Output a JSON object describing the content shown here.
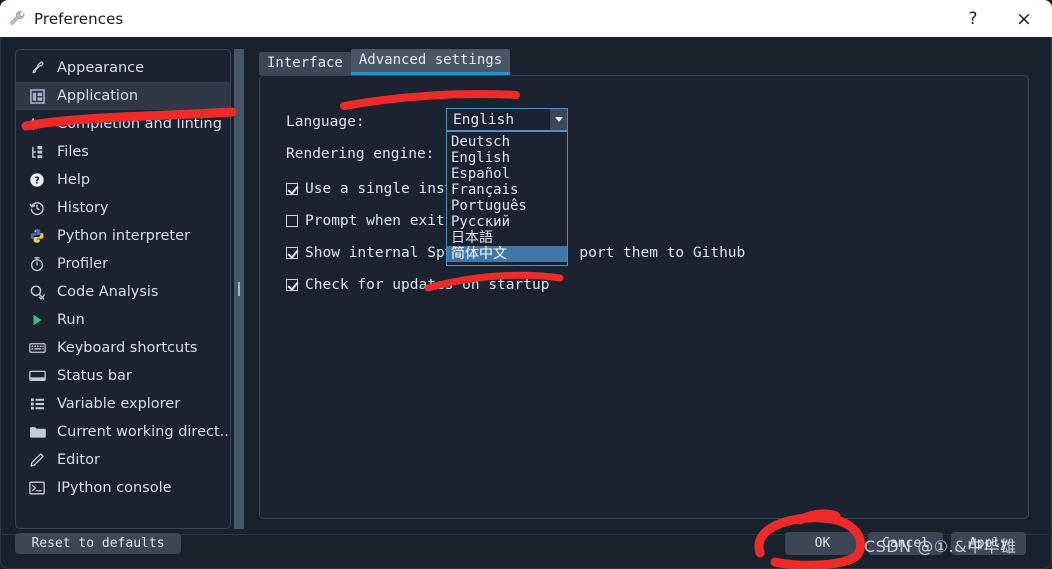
{
  "window": {
    "title": "Preferences",
    "icon": "wrench-icon",
    "help_label": "?",
    "close_label": "×"
  },
  "sidebar": {
    "items": [
      {
        "label": "Appearance",
        "icon": "eyedropper-icon",
        "active": false
      },
      {
        "label": "Application",
        "icon": "application-grid-icon",
        "active": true
      },
      {
        "label": "Completion and linting",
        "icon": "check-arrow-icon",
        "active": false
      },
      {
        "label": "Files",
        "icon": "file-tree-icon",
        "active": false
      },
      {
        "label": "Help",
        "icon": "question-circle-icon",
        "active": false
      },
      {
        "label": "History",
        "icon": "clock-back-icon",
        "active": false
      },
      {
        "label": "Python interpreter",
        "icon": "python-icon",
        "active": false
      },
      {
        "label": "Profiler",
        "icon": "stopwatch-icon",
        "active": false
      },
      {
        "label": "Code Analysis",
        "icon": "magnifier-check-icon",
        "active": false
      },
      {
        "label": "Run",
        "icon": "play-triangle-icon",
        "active": false
      },
      {
        "label": "Keyboard shortcuts",
        "icon": "keyboard-icon",
        "active": false
      },
      {
        "label": "Status bar",
        "icon": "status-bar-icon",
        "active": false
      },
      {
        "label": "Variable explorer",
        "icon": "list-icon",
        "active": false
      },
      {
        "label": "Current working direct...",
        "icon": "folder-icon",
        "active": false
      },
      {
        "label": "Editor",
        "icon": "pencil-icon",
        "active": false
      },
      {
        "label": "IPython console",
        "icon": "terminal-icon",
        "active": false
      }
    ]
  },
  "main": {
    "tabs": [
      {
        "label": "Interface",
        "selected": false
      },
      {
        "label": "Advanced settings",
        "selected": true
      }
    ],
    "language_label": "Language:",
    "rendering_label": "Rendering engine:",
    "language_value": "English",
    "dropdown_options": [
      {
        "label": "Deutsch",
        "selected": false,
        "cjk": false
      },
      {
        "label": "English",
        "selected": false,
        "cjk": false
      },
      {
        "label": "Español",
        "selected": false,
        "cjk": false
      },
      {
        "label": "Français",
        "selected": false,
        "cjk": false
      },
      {
        "label": "Português",
        "selected": false,
        "cjk": false
      },
      {
        "label": "Русский",
        "selected": false,
        "cjk": false
      },
      {
        "label": "日本語",
        "selected": false,
        "cjk": true
      },
      {
        "label": "简体中文",
        "selected": true,
        "cjk": true
      }
    ],
    "checkboxes": [
      {
        "label": "Use a single inst",
        "checked": true
      },
      {
        "label": "Prompt when exiti",
        "checked": false
      },
      {
        "label": "Show internal Spy",
        "checked": true,
        "label_tail": "port them to Github"
      },
      {
        "label": "Check for updates on startup",
        "checked": true
      }
    ]
  },
  "footer": {
    "reset_label": "Reset to defaults",
    "ok_label": "OK",
    "cancel_label": "Cancel",
    "apply_label": "Apply"
  },
  "watermark": {
    "text": "CSDN @①.&中华雄"
  },
  "colors": {
    "window_bg": "#19212c",
    "panel_bg": "#1b2330",
    "border": "#38445a",
    "titlebar_bg": "#ffffff",
    "accent_blue": "#2a8fd6",
    "selection_blue": "#3f77a8",
    "annotation_red": "#ef2b29",
    "text": "#dfe5ee"
  }
}
